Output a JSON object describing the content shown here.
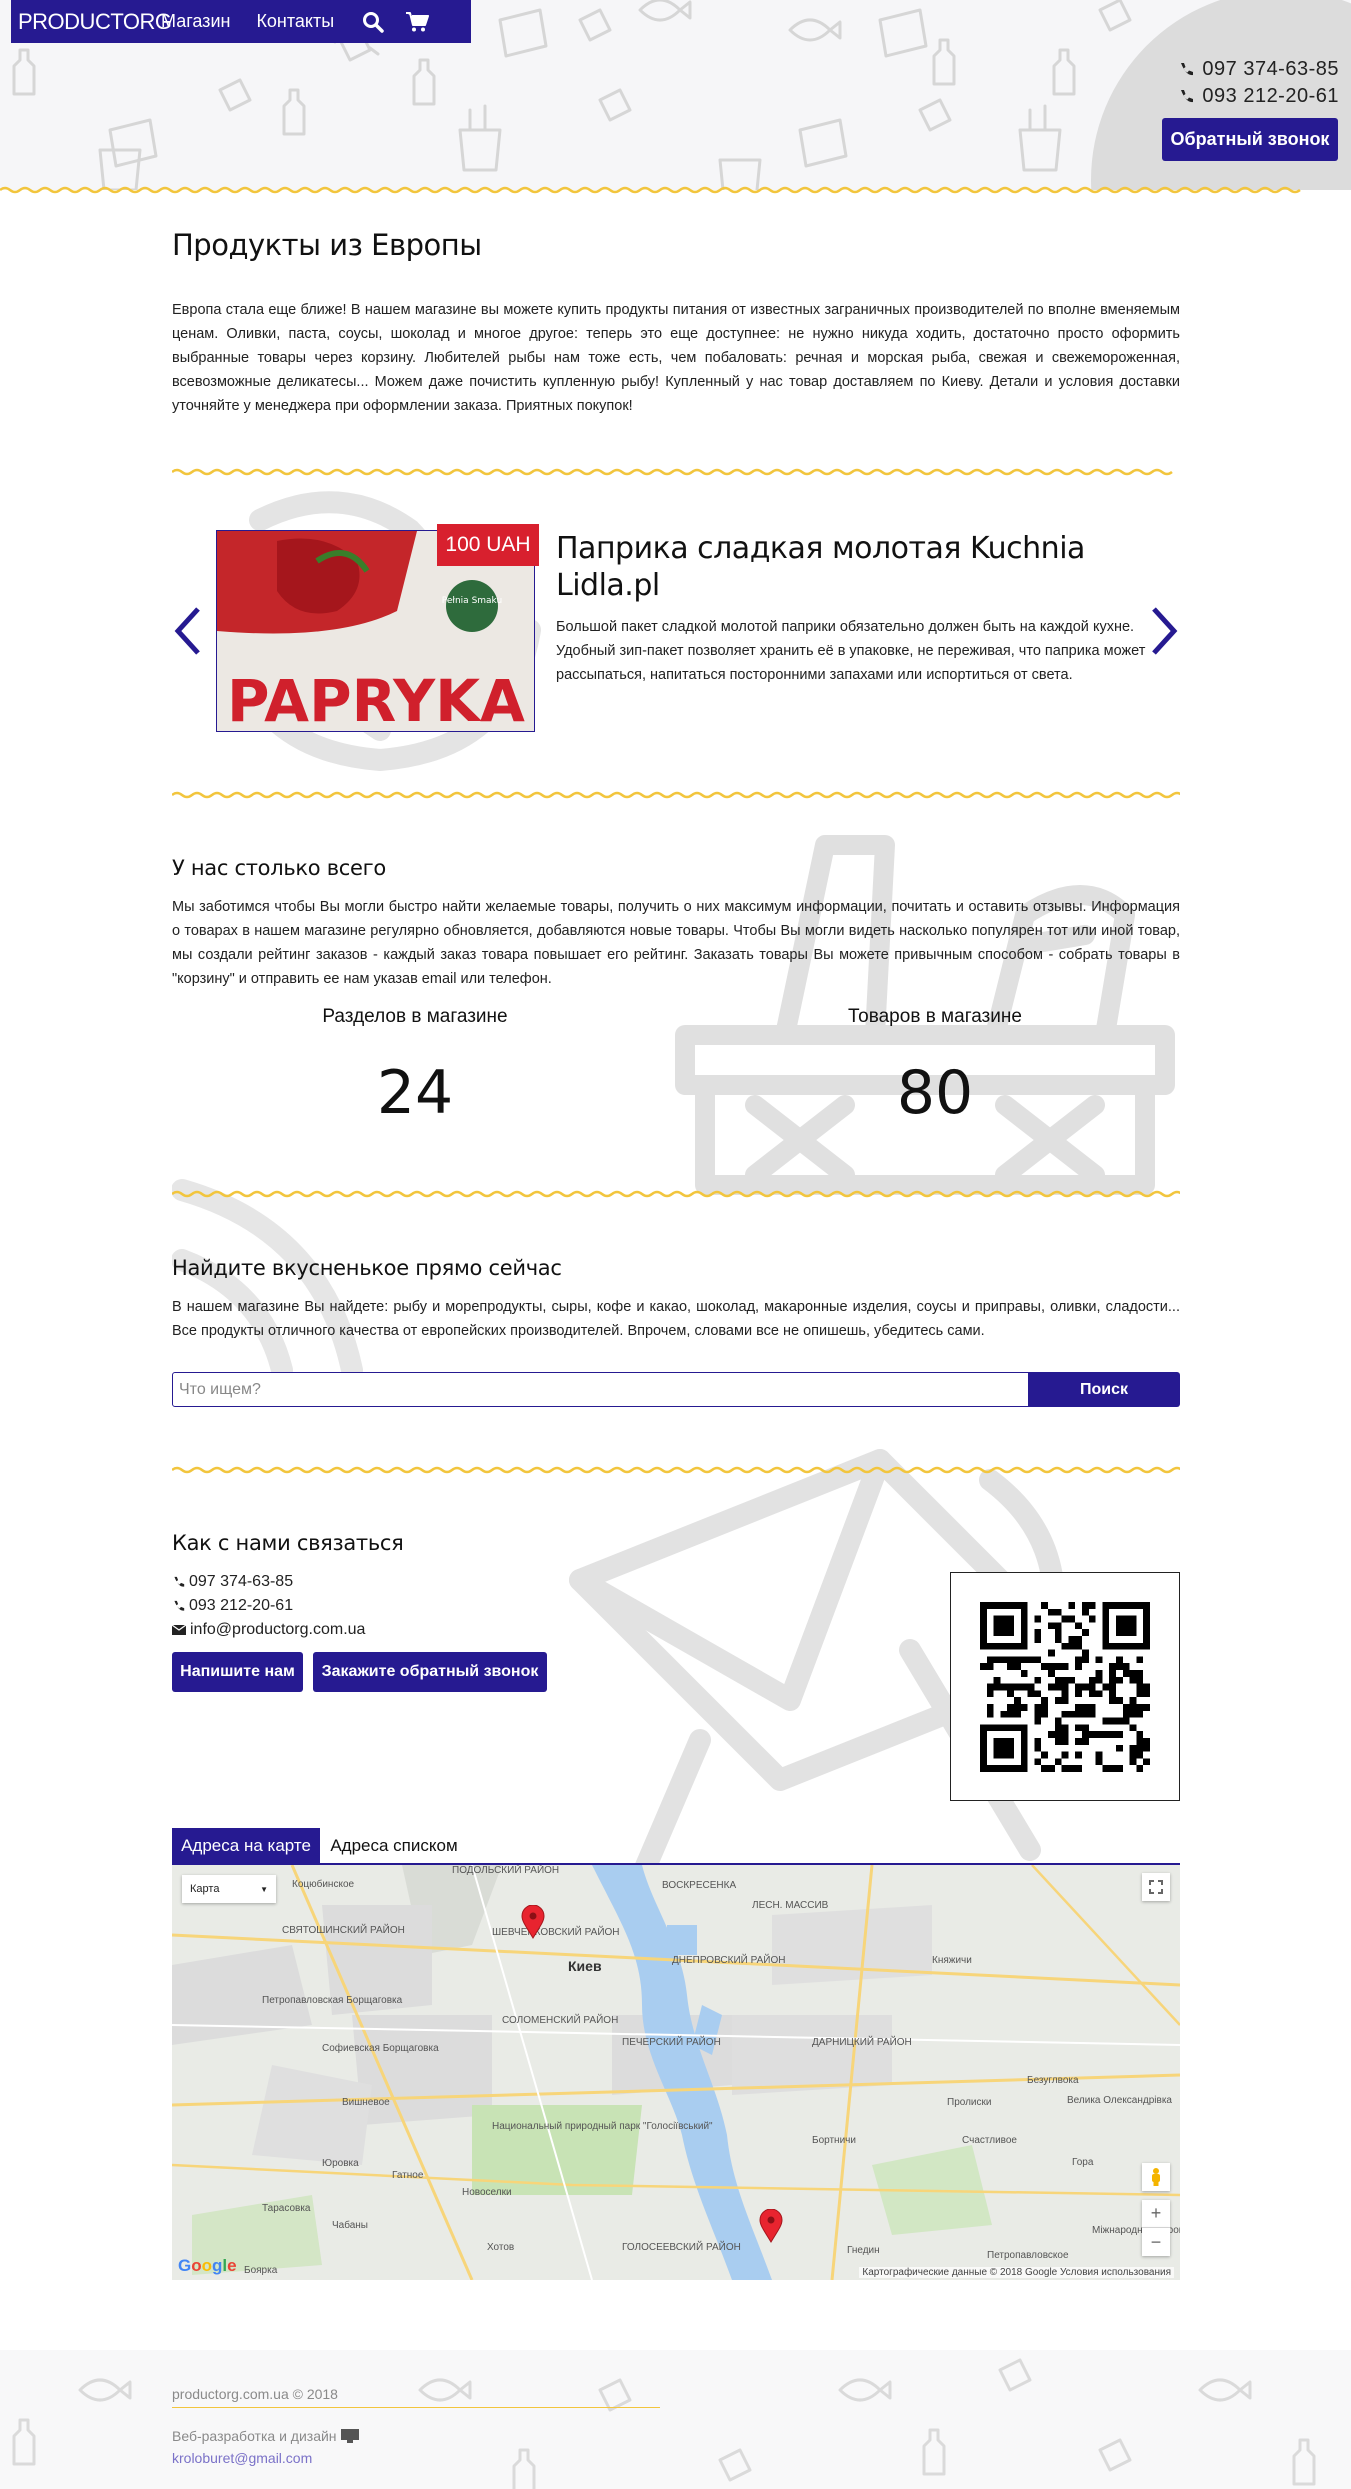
{
  "navbar": {
    "brand": "PRODUCTORG",
    "links": [
      "Магазин",
      "Контакты"
    ]
  },
  "header": {
    "phones": [
      "097  374-63-85",
      "093  212-20-61"
    ],
    "callback_label": "Обратный звонок"
  },
  "intro": {
    "title": "Продукты из Европы",
    "text": "Европа стала еще ближе! В нашем магазине вы можете купить продукты питания от известных заграничных производителей по вполне вменяемым ценам. Оливки, паста, соусы, шоколад и многое другое: теперь это еще доступнее: не нужно никуда ходить, достаточно просто оформить выбранные товары через корзину. Любителей рыбы нам тоже есть, чем побаловать: речная и морская рыба, свежая и свежемороженная, всевозможные деликатесы... Можем даже почистить купленную рыбу! Купленный у нас товар доставляем по Киеву. Детали и условия доставки уточняйте у менеджера при оформлении заказа. Приятных покупок!"
  },
  "slider": {
    "price": "100 UAH",
    "title": "Паприка сладкая молотая Kuchnia Lidla.pl",
    "description": "Большой пакет сладкой молотой паприки обязательно должен быть на каждой кухне. Удобный зип-пакет позволяет хранить её в упаковке, не переживая, что паприка может рассыпаться, напитаться посторонними запахами или испортиться от света.",
    "image_text": "PAPRYKA",
    "image_badge": "Pełnia Smaku"
  },
  "stats": {
    "title": "У нас столько всего",
    "text": "Мы заботимся чтобы Вы могли быстро найти желаемые товары, получить о них максимум информации, почитать и оставить отзывы. Информация о товарах в нашем магазине регулярно обновляется, добавляются новые товары. Чтобы Вы могли видеть насколько популярен тот или иной товар, мы создали рейтинг заказов - каждый заказ товара повышает его рейтинг. Заказать товары Вы можете привычным способом - собрать товары в \"корзину\" и отправить ее нам указав email или телефон.",
    "sections_label": "Разделов в магазине",
    "sections_value": "24",
    "products_label": "Товаров в магазине",
    "products_value": "80"
  },
  "search": {
    "title": "Найдите вкусненькое прямо сейчас",
    "text": "В нашем магазине Вы найдете: рыбу и морепродукты, сыры, кофе и какао, шоколад, макаронные изделия, соусы и приправы, оливки, сладости... Все продукты отличного качества от европейских производителей. Впрочем, словами все не опишешь, убедитесь сами.",
    "placeholder": "Что ищем?",
    "button": "Поиск"
  },
  "contacts": {
    "title": "Как с нами связаться",
    "phone1": "097 374-63-85",
    "phone2": "093 212-20-61",
    "email": "info@productorg.com.ua",
    "write_button": "Напишите нам",
    "callback_button": "Закажите обратный звонок"
  },
  "address_tabs": [
    "Адреса на карте",
    "Адреса списком"
  ],
  "map": {
    "type_label": "Карта",
    "city": "Киев",
    "labels": [
      "ПОДОЛЬСКИЙ РАЙОН",
      "СВЯТОШИНСКИЙ РАЙОН",
      "ШЕВЧЕНКОВСКИЙ РАЙОН",
      "ВОСКРЕСЕНКА",
      "ЛЕСН. МАССИВ",
      "ДНЕПРОВСКИЙ РАЙОН",
      "Коцюбинское",
      "Петропавловская Борщаговка",
      "СОЛОМЕНСКИЙ РАЙОН",
      "ПЕЧЕРСКИЙ РАЙОН",
      "ДАРНИЦКИЙ РАЙОН",
      "Софиевская Борщаговка",
      "Вишневое",
      "Национальный природный парк \"Голосіївський\"",
      "Гатное",
      "Новоселки",
      "Тарасовка",
      "Хотов",
      "ГОЛОСЕЕВСКИЙ РАЙОН",
      "Бортничи",
      "Гнедин",
      "Пролиски",
      "Счастливое",
      "Гора",
      "Велика Олександрівка",
      "Безуглвока",
      "Княжичи",
      "Боярка",
      "Чабаны",
      "Юровка",
      "Петропавловское",
      "Міжнародний аеропорт Бориспіль"
    ],
    "attribution": "Картографические данные © 2018 Google   Условия использования",
    "google": "Google"
  },
  "footer": {
    "copyright": "productorg.com.ua © 2018",
    "dev_label": "Веб-разработка и дизайн",
    "dev_email": "kroloburet@gmail.com"
  },
  "colors": {
    "primary": "#261a91",
    "accent_wave": "#f2c53d",
    "price_badge": "#d8202e"
  }
}
